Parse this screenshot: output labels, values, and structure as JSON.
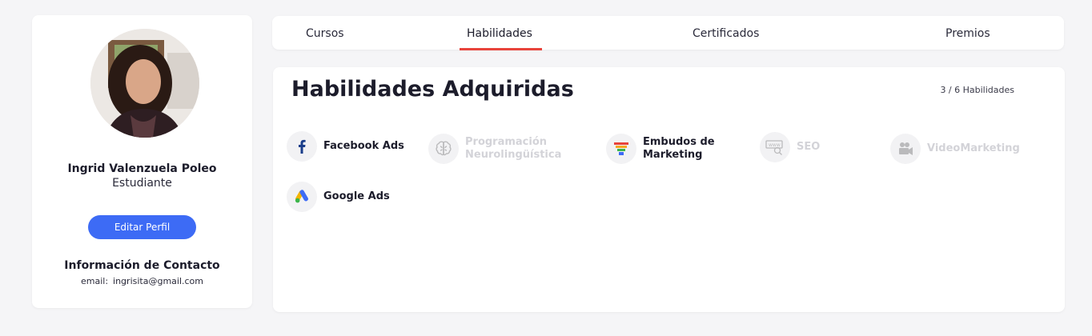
{
  "profile": {
    "name": "Ingrid Valenzuela Poleo",
    "role": "Estudiante",
    "edit_label": "Editar Perfil",
    "contact_title": "Información de Contacto",
    "email_label": "email:",
    "email_value": "ingrisita@gmail.com"
  },
  "tabs": [
    {
      "label": "Cursos",
      "active": false
    },
    {
      "label": "Habilidades",
      "active": true
    },
    {
      "label": "Certificados",
      "active": false
    },
    {
      "label": "Premios",
      "active": false
    }
  ],
  "skills_section": {
    "title": "Habilidades Adquiridas",
    "count": "3 / 6 Habilidades",
    "items": [
      {
        "label_line1": "Facebook Ads",
        "label_line2": "",
        "icon": "facebook-icon",
        "acquired": true
      },
      {
        "label_line1": "Programación",
        "label_line2": "Neurolingüística",
        "icon": "brain-icon",
        "acquired": false
      },
      {
        "label_line1": "Embudos de",
        "label_line2": "Marketing",
        "icon": "funnel-icon",
        "acquired": true
      },
      {
        "label_line1": "SEO",
        "label_line2": "",
        "icon": "seo-icon",
        "acquired": false
      },
      {
        "label_line1": "VideoMarketing",
        "label_line2": "",
        "icon": "video-camera-icon",
        "acquired": false
      },
      {
        "label_line1": "Google Ads",
        "label_line2": "",
        "icon": "google-ads-icon",
        "acquired": true
      }
    ]
  },
  "colors": {
    "accent": "#3d6bf5",
    "tab_underline": "#e8433b",
    "locked_text": "#d3d3d8"
  }
}
